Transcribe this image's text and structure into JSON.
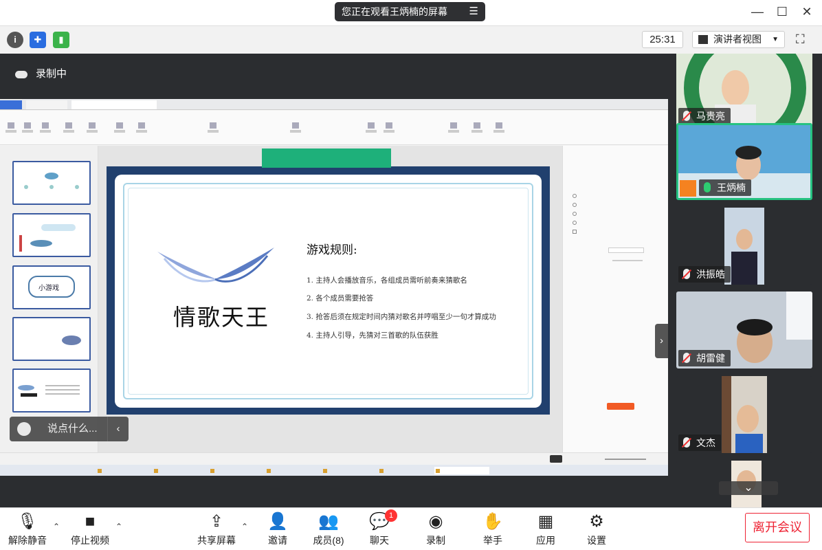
{
  "top": {
    "viewing_text": "您正在观看王炳楠的屏幕"
  },
  "toolbar": {
    "timer": "25:31",
    "view_mode": "演讲者视图"
  },
  "recording": {
    "label": "录制中"
  },
  "slide": {
    "title": "情歌天王",
    "rules_heading": "游戏规则:",
    "rules": [
      "1. 主持人会播放音乐，各组成员需听前奏来猜歌名",
      "2. 各个成员需要抢答",
      "3. 抢答后须在规定时间内猜对歌名并哼唱至少一句才算成功",
      "4. 主持人引导，先猜对三首歌的队伍获胜"
    ]
  },
  "thumbnail_text": {
    "t3": "小游戏"
  },
  "chat": {
    "placeholder": "说点什么..."
  },
  "participants": [
    {
      "name": "马贵亮",
      "mic": "off"
    },
    {
      "name": "王炳楠",
      "mic": "on"
    },
    {
      "name": "洪振皓",
      "mic": "off"
    },
    {
      "name": "胡雷健",
      "mic": "off"
    },
    {
      "name": "文杰",
      "mic": "off"
    }
  ],
  "bottom": {
    "mute": "解除静音",
    "video": "停止视频",
    "share": "共享屏幕",
    "invite": "邀请",
    "members": "成员(8)",
    "chat": "聊天",
    "chat_badge": "1",
    "record": "录制",
    "raise_hand": "举手",
    "apps": "应用",
    "settings": "设置",
    "leave": "离开会议"
  },
  "colors": {
    "accent_green": "#26c281",
    "leave_red": "#e22233",
    "slide_bg": "#21406e"
  }
}
